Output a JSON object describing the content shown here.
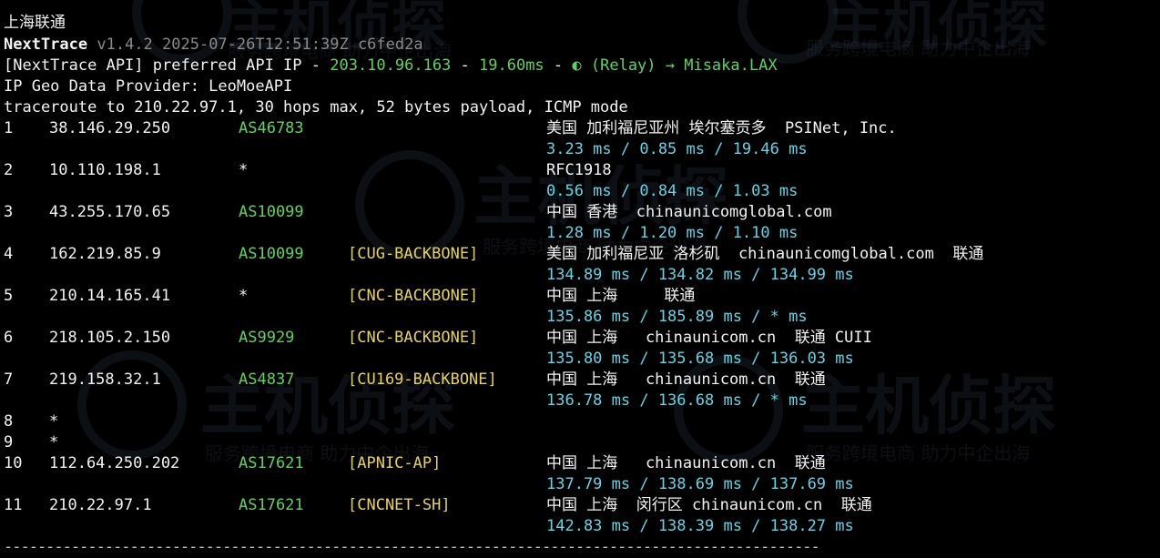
{
  "separator": "-------------------------------------------------------------------------------------------------",
  "location_title": "上海联通",
  "header": {
    "app_name": "NextTrace",
    "version_info": "v1.4.2 2025-07-26T12:51:39Z c6fed2a",
    "api_line_prefix": "[NextTrace API] preferred API IP - ",
    "api_ip": "203.10.96.163",
    "api_sep1": " - ",
    "api_latency": "19.60ms",
    "api_sep2": " - ",
    "api_relay": "(Relay) → Misaka.LAX",
    "geo_provider": "IP Geo Data Provider: LeoMoeAPI",
    "traceroute_info": "traceroute to 210.22.97.1, 30 hops max, 52 bytes payload, ICMP mode"
  },
  "hops": [
    {
      "num": "1",
      "ip": "38.146.29.250",
      "asn": "AS46783",
      "tag": "",
      "geo": "美国 加利福尼亚州 埃尔塞贡多  PSINet, Inc.",
      "rtt": "3.23 ms / 0.85 ms / 19.46 ms"
    },
    {
      "num": "2",
      "ip": "10.110.198.1",
      "asn": "*",
      "tag": "",
      "geo": "RFC1918",
      "rtt": "0.56 ms / 0.84 ms / 1.03 ms"
    },
    {
      "num": "3",
      "ip": "43.255.170.65",
      "asn": "AS10099",
      "tag": "",
      "geo": "中国 香港  chinaunicomglobal.com",
      "rtt": "1.28 ms / 1.20 ms / 1.10 ms"
    },
    {
      "num": "4",
      "ip": "162.219.85.9",
      "asn": "AS10099",
      "tag": "[CUG-BACKBONE]",
      "geo": "美国 加利福尼亚 洛杉矶  chinaunicomglobal.com  联通",
      "rtt": "134.89 ms / 134.82 ms / 134.99 ms"
    },
    {
      "num": "5",
      "ip": "210.14.165.41",
      "asn": "*",
      "tag": "[CNC-BACKBONE]",
      "geo": "中国 上海     联通",
      "rtt": "135.86 ms / 185.89 ms / * ms"
    },
    {
      "num": "6",
      "ip": "218.105.2.150",
      "asn": "AS9929",
      "tag": "[CNC-BACKBONE]",
      "geo": "中国 上海   chinaunicom.cn  联通 CUII",
      "rtt": "135.80 ms / 135.68 ms / 136.03 ms"
    },
    {
      "num": "7",
      "ip": "219.158.32.1",
      "asn": "AS4837",
      "tag": "[CU169-BACKBONE]",
      "geo": "中国 上海   chinaunicom.cn  联通",
      "rtt": "136.78 ms / 136.68 ms / * ms"
    },
    {
      "num": "8",
      "ip": "*",
      "asn": "",
      "tag": "",
      "geo": "",
      "rtt": ""
    },
    {
      "num": "9",
      "ip": "*",
      "asn": "",
      "tag": "",
      "geo": "",
      "rtt": ""
    },
    {
      "num": "10",
      "ip": "112.64.250.202",
      "asn": "AS17621",
      "tag": "[APNIC-AP]",
      "geo": "中国 上海   chinaunicom.cn  联通",
      "rtt": "137.79 ms / 138.69 ms / 137.69 ms"
    },
    {
      "num": "11",
      "ip": "210.22.97.1",
      "asn": "AS17621",
      "tag": "[CNCNET-SH]",
      "geo": "中国 上海  闵行区 chinaunicom.cn  联通",
      "rtt": "142.83 ms / 138.39 ms / 138.27 ms"
    }
  ],
  "watermark": {
    "logo_text": "主机侦探",
    "slogan": "服务跨境电商 助力中企出海"
  },
  "colors": {
    "background": "#000000",
    "asn_green": "#5fd35f",
    "tag_yellow": "#e6d35a",
    "rtt_cyan": "#5fd7e6"
  }
}
